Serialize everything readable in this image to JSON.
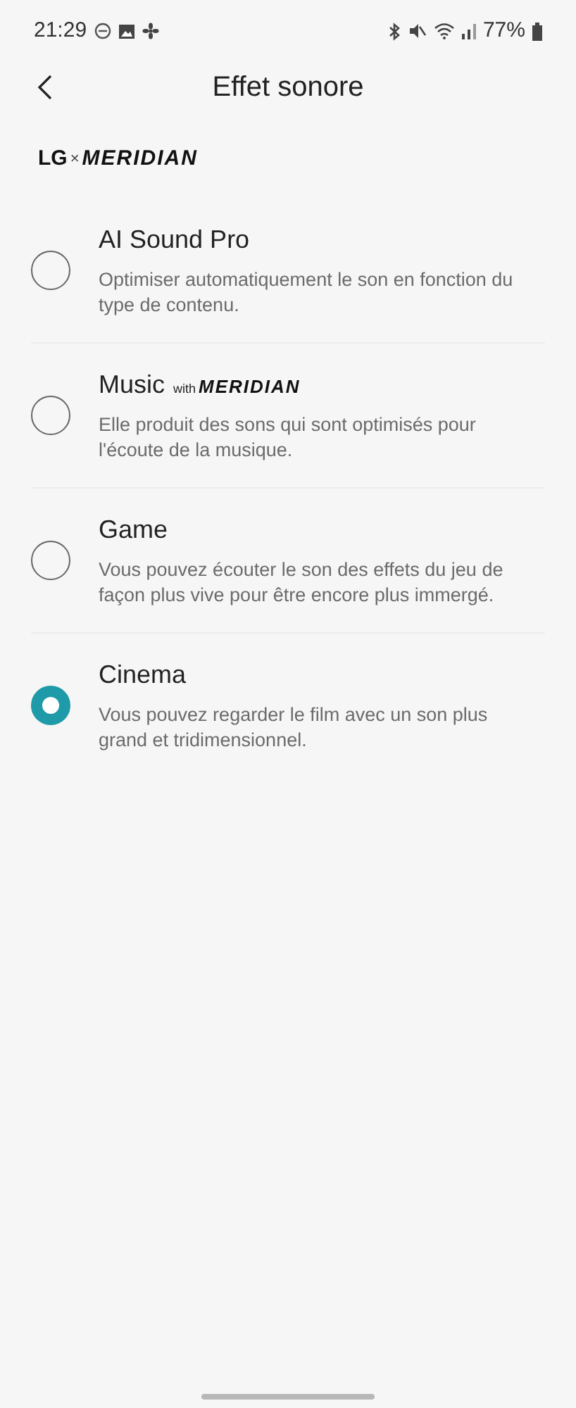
{
  "status_bar": {
    "time": "21:29",
    "battery": "77%"
  },
  "header": {
    "title": "Effet sonore"
  },
  "brand": {
    "left": "LG",
    "mark": "×",
    "right": "MERIDIAN"
  },
  "options": [
    {
      "title": "AI Sound Pro",
      "description": "Optimiser automatiquement le son en fonction du type de contenu.",
      "selected": false
    },
    {
      "title": "Music",
      "badge_prefix": "with",
      "badge": "MERIDIAN",
      "description": "Elle produit des sons qui sont optimisés pour l'écoute de la musique.",
      "selected": false
    },
    {
      "title": "Game",
      "description": "Vous pouvez écouter le son des effets du jeu de façon plus vive pour être encore plus immergé.",
      "selected": false
    },
    {
      "title": "Cinema",
      "description": "Vous pouvez regarder le film avec un son plus grand et tridimensionnel.",
      "selected": true
    }
  ]
}
